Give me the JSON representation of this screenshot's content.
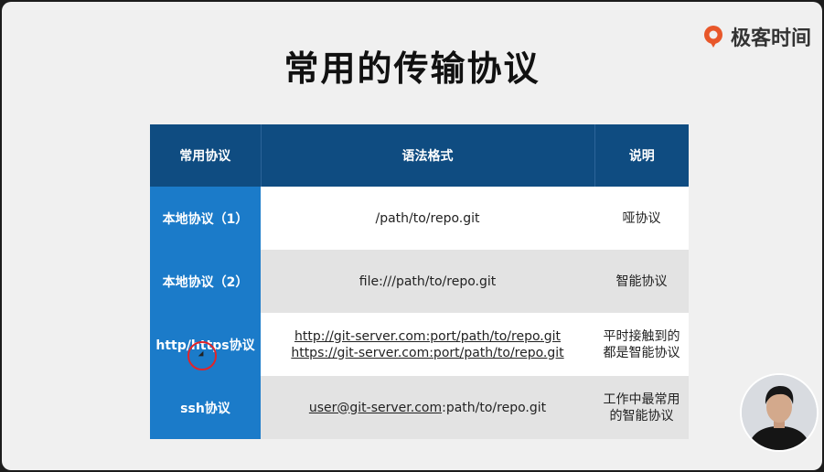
{
  "slide": {
    "title": "常用的传输协议",
    "brand": "极客时间"
  },
  "table": {
    "headers": [
      "常用协议",
      "语法格式",
      "说明"
    ],
    "rows": [
      {
        "protocol": "本地协议（1）",
        "syntax": [
          "/path/to/repo.git"
        ],
        "note": [
          "哑协议"
        ]
      },
      {
        "protocol": "本地协议（2）",
        "syntax": [
          "file:///path/to/repo.git"
        ],
        "note": [
          "智能协议"
        ]
      },
      {
        "protocol": "http/https协议",
        "syntax": [
          "http://git-server.com:port/path/to/repo.git",
          "https://git-server.com:port/path/to/repo.git"
        ],
        "note": [
          "平时接触到的",
          "都是智能协议"
        ]
      },
      {
        "protocol": "ssh协议",
        "syntax_parts": [
          "user@git-server.com",
          ":path/to/repo.git"
        ],
        "note": [
          "工作中最常用",
          "的智能协议"
        ]
      }
    ]
  },
  "colors": {
    "header_bg": "#0f4c81",
    "first_col_bg": "#1b7bc9",
    "brand_orange": "#e8572a",
    "cursor_ring": "#e0242a"
  },
  "icons": {
    "logo": "geektime-logo-icon",
    "cursor": "mouse-pointer-icon",
    "presenter": "presenter-webcam"
  }
}
